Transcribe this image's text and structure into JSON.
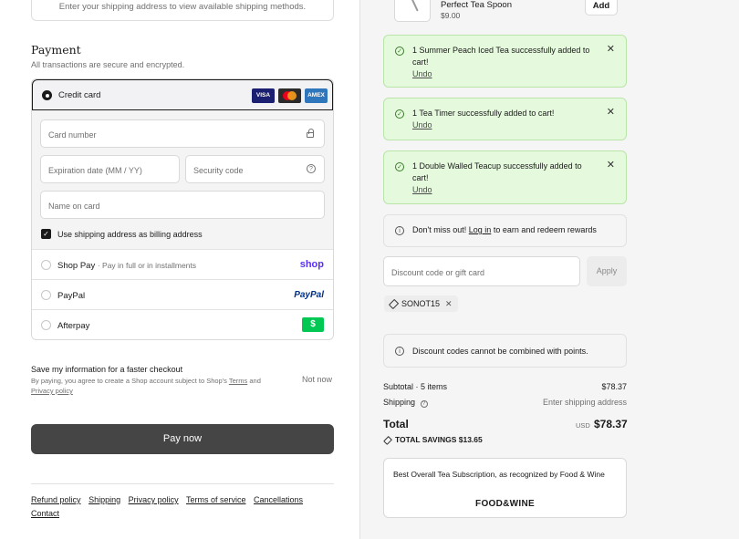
{
  "shipping_note": "Enter your shipping address to view available shipping methods.",
  "payment": {
    "title": "Payment",
    "subtitle": "All transactions are secure and encrypted.",
    "credit_card_label": "Credit card",
    "card_logos": [
      "VISA",
      "MC",
      "AMEX"
    ],
    "fields": {
      "card_number": "Card number",
      "expiration": "Expiration date (MM / YY)",
      "security_code": "Security code",
      "name_on_card": "Name on card"
    },
    "billing_checkbox": "Use shipping address as billing address",
    "methods": [
      {
        "name": "Shop Pay",
        "desc": "· Pay in full or in installments",
        "logo": "shop"
      },
      {
        "name": "PayPal",
        "logo": "PayPal"
      },
      {
        "name": "Afterpay",
        "logo": "$"
      }
    ]
  },
  "save_info": {
    "title": "Save my information for a faster checkout",
    "fine_print_1": "By paying, you agree to create a Shop account subject to Shop's",
    "terms": "Terms",
    "and": "and",
    "privacy": "Privacy policy",
    "not_now": "Not now"
  },
  "pay_now": "Pay now",
  "footer": [
    "Refund policy",
    "Shipping",
    "Privacy policy",
    "Terms of service",
    "Cancellations",
    "Contact"
  ],
  "product": {
    "name": "Perfect Tea Spoon",
    "price": "$9.00",
    "add": "Add"
  },
  "toasts": [
    {
      "msg": "1 Summer Peach Iced Tea successfully added to cart!",
      "undo": "Undo"
    },
    {
      "msg": "1 Tea Timer successfully added to cart!",
      "undo": "Undo"
    },
    {
      "msg": "1 Double Walled Teacup successfully added to cart!",
      "undo": "Undo"
    }
  ],
  "rewards": {
    "pre": "Don't miss out!",
    "link": "Log in",
    "post": "to earn and redeem rewards"
  },
  "discount": {
    "placeholder": "Discount code or gift card",
    "apply": "Apply",
    "code": "SONOT15"
  },
  "discount_notice": "Discount codes cannot be combined with points.",
  "summary": {
    "subtotal_label": "Subtotal · 5 items",
    "subtotal": "$78.37",
    "shipping_label": "Shipping",
    "shipping_value": "Enter shipping address",
    "total_label": "Total",
    "currency": "USD",
    "total": "$78.37",
    "savings": "TOTAL SAVINGS  $13.65"
  },
  "promo": {
    "text": "Best Overall Tea Subscription, as recognized by Food & Wine",
    "logo": "FOOD&WINE"
  }
}
